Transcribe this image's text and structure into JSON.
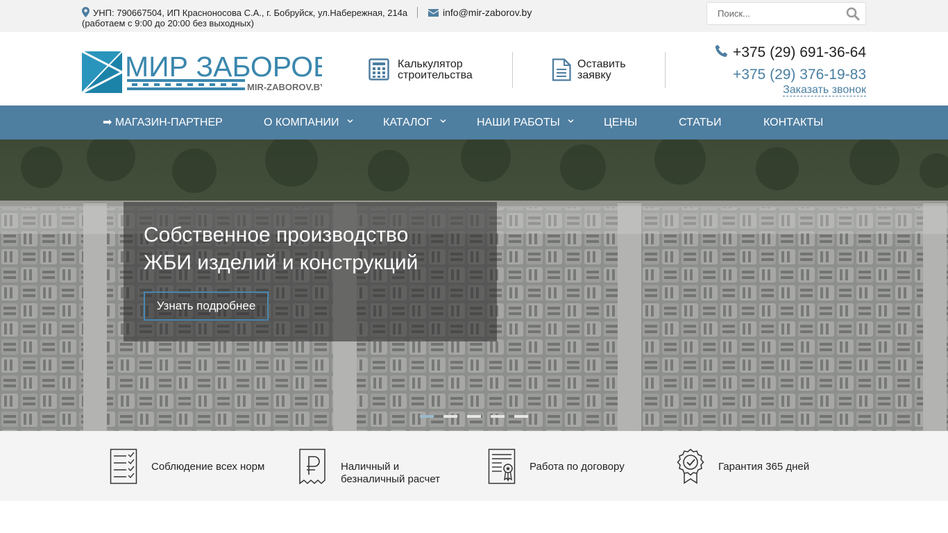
{
  "topbar": {
    "address_line1": "УНП: 790667504, ИП Красноносова С.А., г. Бобруйск, ул.Набережная, 214а",
    "address_line2": "(работаем с 9:00 до 20:00 без выходных)",
    "email": "info@mir-zaborov.by",
    "search_placeholder": "Поиск..."
  },
  "header": {
    "logo_text": "МИР ЗАБОРОВ",
    "logo_sub": "MIR-ZABOROV.BY",
    "calculator_line1": "Калькулятор",
    "calculator_line2": "строительства",
    "request_line1": "Оставить",
    "request_line2": "заявку",
    "phone_primary": "+375 (29) 691-36-64",
    "phone_secondary": "+375 (29) 376-19-83",
    "callback_label": "Заказать звонок"
  },
  "nav": {
    "items": [
      {
        "label": "➡ МАГАЗИН-ПАРТНЕР"
      },
      {
        "label": "О КОМПАНИИ"
      },
      {
        "label": "КАТАЛОГ"
      },
      {
        "label": "НАШИ РАБОТЫ"
      },
      {
        "label": "ЦЕНЫ"
      },
      {
        "label": "СТАТЬИ"
      },
      {
        "label": "КОНТАКТЫ"
      }
    ]
  },
  "hero": {
    "title_line1": "Собственное производство",
    "title_line2": "ЖБИ изделий и конструкций",
    "button_label": "Узнать подробнее",
    "slides_count": 5,
    "active_slide": 1
  },
  "features": [
    {
      "icon": "checklist-icon",
      "line1": "Соблюдение всех норм",
      "line2": ""
    },
    {
      "icon": "ruble-receipt-icon",
      "line1": "Наличный и",
      "line2": "безналичный расчет"
    },
    {
      "icon": "contract-icon",
      "line1": "Работа по договору",
      "line2": ""
    },
    {
      "icon": "guarantee-badge-icon",
      "line1": "Гарантия 365 дней",
      "line2": ""
    }
  ],
  "colors": {
    "accent": "#4e7ea0",
    "link": "#4a7fa2",
    "topbar_bg": "#f2f2f2",
    "features_bg": "#f4f4f4"
  }
}
